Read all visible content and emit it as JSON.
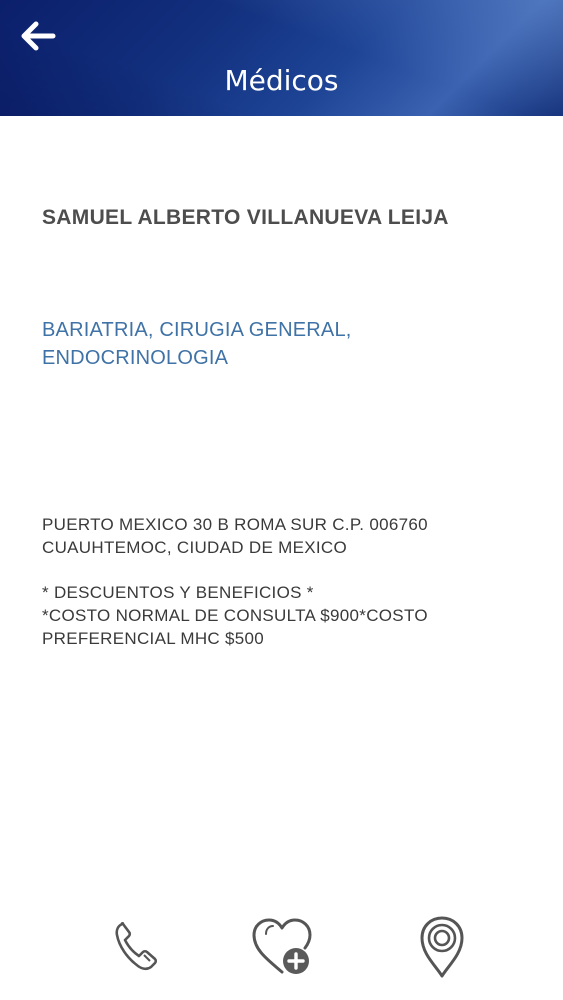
{
  "header": {
    "title": "Médicos",
    "back_icon": "back-arrow-icon",
    "gradient_colors": [
      "#0b1f6b",
      "#1e4496",
      "#3a62b0"
    ]
  },
  "doctor": {
    "name": "SAMUEL ALBERTO VILLANUEVA LEIJA",
    "specialties": "BARIATRIA, CIRUGIA GENERAL,\nENDOCRINOLOGIA",
    "address": " PUERTO MEXICO 30 B ROMA SUR C.P. 006760\nCUAUHTEMOC, CIUDAD DE MEXICO",
    "benefits": "* DESCUENTOS Y BENEFICIOS *\n*COSTO NORMAL DE CONSULTA $900*COSTO\nPREFERENCIAL MHC $500"
  },
  "actions": [
    {
      "icon": "phone-icon"
    },
    {
      "icon": "heart-plus-icon"
    },
    {
      "icon": "map-pin-icon"
    }
  ],
  "colors": {
    "name_text": "#4d4d4d",
    "specialty_text": "#3f72a6",
    "body_text": "#3a3a3a",
    "icon_stroke": "#555555"
  }
}
